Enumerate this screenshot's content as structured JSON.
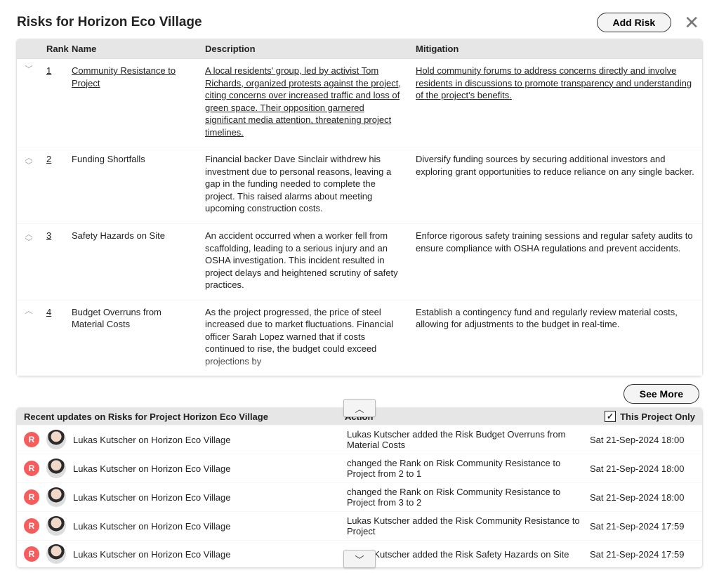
{
  "header": {
    "title": "Risks for Horizon Eco Village",
    "add_button": "Add Risk"
  },
  "columns": {
    "rank": "Rank",
    "name": "Name",
    "description": "Description",
    "mitigation": "Mitigation"
  },
  "risks": [
    {
      "rank": "1",
      "name": "Community Resistance to Project",
      "description": "A local residents' group, led by activist Tom Richards, organized protests against the project, citing concerns over increased traffic and loss of green space. Their opposition garnered significant media attention, threatening project timelines.",
      "mitigation": "Hold community forums to address concerns directly and involve residents in discussions to promote transparency and understanding of the project's benefits.",
      "arrows": "down",
      "style": "linked"
    },
    {
      "rank": "2",
      "name": "Funding Shortfalls",
      "description": "Financial backer Dave Sinclair withdrew his investment due to personal reasons, leaving a gap in the funding needed to complete the project. This raised alarms about meeting upcoming construction costs.",
      "mitigation": "Diversify funding sources by securing additional investors and exploring grant opportunities to reduce reliance on any single backer.",
      "arrows": "both",
      "style": "plain"
    },
    {
      "rank": "3",
      "name": "Safety Hazards on Site",
      "description": "An accident occurred when a worker fell from scaffolding, leading to a serious injury and an OSHA investigation. This incident resulted in project delays and heightened scrutiny of safety practices.",
      "mitigation": "Enforce rigorous safety training sessions and regular safety audits to ensure compliance with OSHA regulations and prevent accidents.",
      "arrows": "both",
      "style": "plain"
    },
    {
      "rank": "4",
      "name": "Budget Overruns from Material Costs",
      "description": "As the project progressed, the price of steel increased due to market fluctuations. Financial officer Sarah Lopez warned that if costs continued to rise, the budget could exceed projections by",
      "mitigation": "Establish a contingency fund and regularly review material costs, allowing for adjustments to the budget in real-time.",
      "arrows": "up",
      "style": "plain"
    }
  ],
  "see_more": "See More",
  "updates_header": {
    "title": "Recent updates on Risks for Project Horizon Eco Village",
    "action": "Action",
    "filter_label": "This Project Only"
  },
  "updates": [
    {
      "who": "Lukas Kutscher on Horizon Eco Village",
      "action": "Lukas Kutscher added the Risk Budget Overruns from Material Costs",
      "time": "Sat 21-Sep-2024 18:00"
    },
    {
      "who": "Lukas Kutscher on Horizon Eco Village",
      "action": "changed the Rank on Risk Community Resistance to Project from 2 to 1",
      "time": "Sat 21-Sep-2024 18:00"
    },
    {
      "who": "Lukas Kutscher on Horizon Eco Village",
      "action": "changed the Rank on Risk Community Resistance to Project from 3 to 2",
      "time": "Sat 21-Sep-2024 18:00"
    },
    {
      "who": "Lukas Kutscher on Horizon Eco Village",
      "action": "Lukas Kutscher added the Risk Community Resistance to Project",
      "time": "Sat 21-Sep-2024 17:59"
    },
    {
      "who": "Lukas Kutscher on Horizon Eco Village",
      "action": "Lukas Kutscher added the Risk Safety Hazards on Site",
      "time": "Sat 21-Sep-2024 17:59"
    }
  ],
  "badge_letter": "R"
}
